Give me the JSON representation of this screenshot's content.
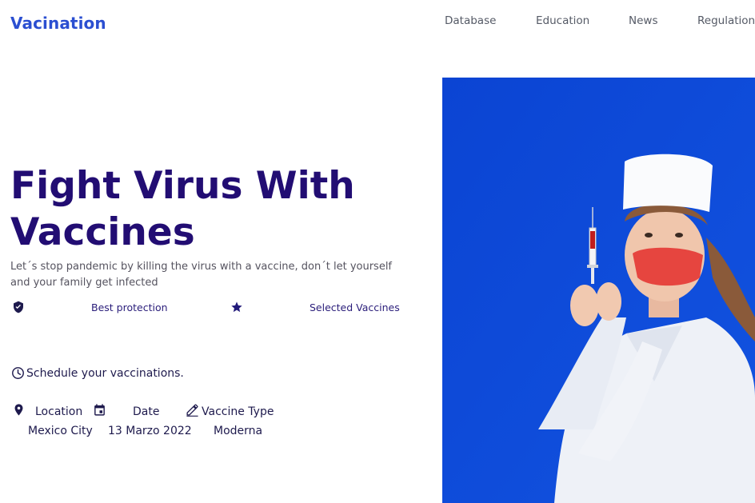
{
  "brand": {
    "name": "Vacination"
  },
  "nav": {
    "items": [
      "Database",
      "Education",
      "News",
      "Regulation"
    ]
  },
  "hero": {
    "title_line1": "Fight Virus With",
    "title_line2": "Vaccines",
    "subtitle": "Let´s stop pandemic by killing the virus with a vaccine, don´t let yourself and your family get infected",
    "features": [
      {
        "icon": "shield-icon",
        "label": "Best protection"
      },
      {
        "icon": "star-icon",
        "label": "Selected Vaccines"
      }
    ]
  },
  "schedule": {
    "title": "Schedule your vaccinations.",
    "fields": [
      {
        "icon": "location-pin-icon",
        "label": "Location",
        "value": "Mexico City"
      },
      {
        "icon": "calendar-icon",
        "label": "Date",
        "value": "13 Marzo 2022"
      },
      {
        "icon": "pen-icon",
        "label": "Vaccine Type",
        "value": "Moderna"
      }
    ]
  },
  "colors": {
    "brand": "#2b4fd1",
    "title": "#220d73",
    "photo_background": "#0c47d6"
  }
}
